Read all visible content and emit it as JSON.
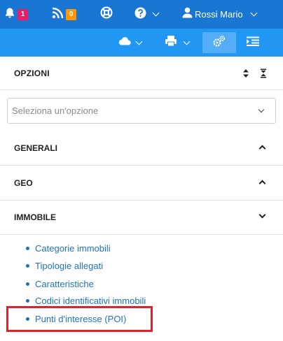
{
  "topbar": {
    "notifications_badge": "1",
    "feed_badge": "0",
    "user_name": "Rossi Mario",
    "colors": {
      "bar": "#1976d2",
      "notif_badge": "#e91e63",
      "feed_badge": "#ff9800"
    }
  },
  "toolbar": {
    "icons": [
      "cloud-icon",
      "printer-icon",
      "settings-gears-icon",
      "list-indent-icon"
    ],
    "active": "settings-gears-icon"
  },
  "panel": {
    "title": "OPZIONI",
    "select_placeholder": "Seleziona un'opzione",
    "sections": [
      {
        "label": "GENERALI",
        "state": "expanded"
      },
      {
        "label": "GEO",
        "state": "expanded"
      },
      {
        "label": "IMMOBILE",
        "state": "collapsed"
      }
    ],
    "links": [
      "Categorie immobili",
      "Tipologie allegati",
      "Caratteristiche",
      "Codici identificativi immobili",
      "Punti d'interesse (POI)"
    ],
    "highlighted_link": "Punti d'interesse (POI)"
  }
}
